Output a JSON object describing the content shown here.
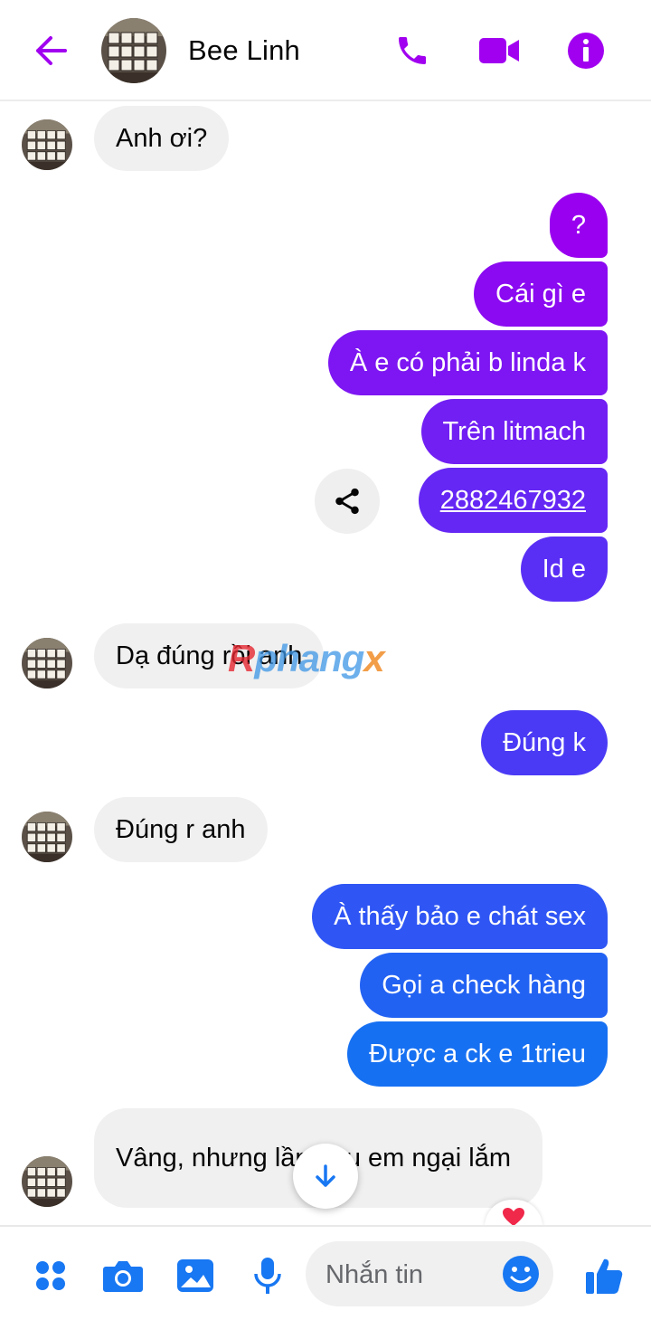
{
  "header": {
    "contact_name": "Bee Linh",
    "icons": [
      "back-arrow-icon",
      "phone-icon",
      "video-camera-icon",
      "info-icon"
    ],
    "accent_color": "#a100f0"
  },
  "messages": [
    {
      "side": "in",
      "text": "Anh ơi?"
    },
    {
      "side": "out",
      "text": "?"
    },
    {
      "side": "out",
      "text": "Cái gì e"
    },
    {
      "side": "out",
      "text": "À e có phải b linda k"
    },
    {
      "side": "out",
      "text": "Trên litmach"
    },
    {
      "side": "out",
      "text": "2882467932"
    },
    {
      "side": "out",
      "text": "Id e"
    },
    {
      "side": "in",
      "text": "Dạ đúng rồi anh"
    },
    {
      "side": "out",
      "text": "Đúng k"
    },
    {
      "side": "in",
      "text": "Đúng r anh"
    },
    {
      "side": "out",
      "text": "À thấy bảo e chát sex"
    },
    {
      "side": "out",
      "text": "Gọi a check hàng"
    },
    {
      "side": "out",
      "text": "Được a  ck e 1trieu"
    },
    {
      "side": "in",
      "text": "Vâng, nhưng lần đầu em ngại lắm"
    }
  ],
  "watermark": {
    "part1": "R",
    "part2": "phang",
    "part3": "x"
  },
  "reaction": "heart-icon",
  "composer": {
    "placeholder": "Nhắn tin",
    "icons": [
      "menu-dots-icon",
      "camera-icon",
      "gallery-icon",
      "microphone-icon",
      "emoji-icon",
      "thumbs-up-icon"
    ]
  },
  "colors": {
    "gradient_top": "#9a00f0",
    "gradient_mid": "#5f33f6",
    "gradient_bottom": "#1670f2",
    "incoming_bubble": "#f0f0f0",
    "composer_icon": "#1877f2"
  }
}
